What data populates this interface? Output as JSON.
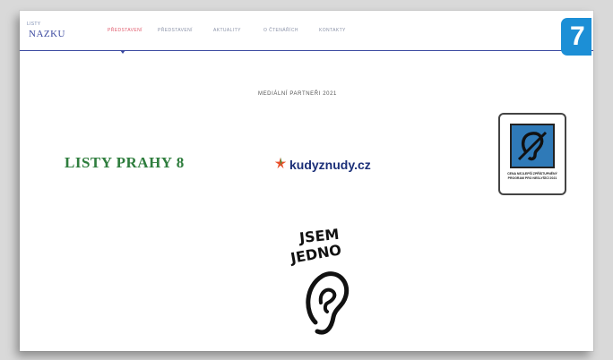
{
  "header": {
    "logo_small": "LISTY",
    "logo_main": "NAZKU",
    "nav": [
      {
        "label": "PŘEDSTAVENÍ",
        "active": true
      },
      {
        "label": "PŘEDSTAVENÍ",
        "active": false
      },
      {
        "label": "AKTUALITY",
        "active": false
      },
      {
        "label": "O ČTENÁŘÍCH",
        "active": false
      },
      {
        "label": "KONTAKTY",
        "active": false
      }
    ]
  },
  "badge": {
    "number": "7"
  },
  "main": {
    "title": "MEDIÁLNÍ PARTNEŘI 2021"
  },
  "partners": {
    "listy": "LISTY PRAHY 8",
    "kudy": "kudyznudy.cz",
    "ucho_text": "CENA NEJLEPŠÍ ZPŘÍSTUPNĚNÝ PROGRAM PRO NESLYŠÍCÍ 2021",
    "jsem_line1": "JSEM",
    "jsem_line2": "JEDNO"
  },
  "colors": {
    "accent": "#3c4aa0",
    "active_nav": "#e05a6c",
    "badge": "#1c8fd6",
    "listy_green": "#2e7d3d",
    "kudy_blue": "#1b2f78",
    "ucho_blue": "#2f7ab8"
  },
  "icons": {
    "search": "search-icon",
    "kudy_star": "star-icon",
    "ucho": "ear-icon",
    "jsem_ear": "ear-drawing-icon"
  }
}
